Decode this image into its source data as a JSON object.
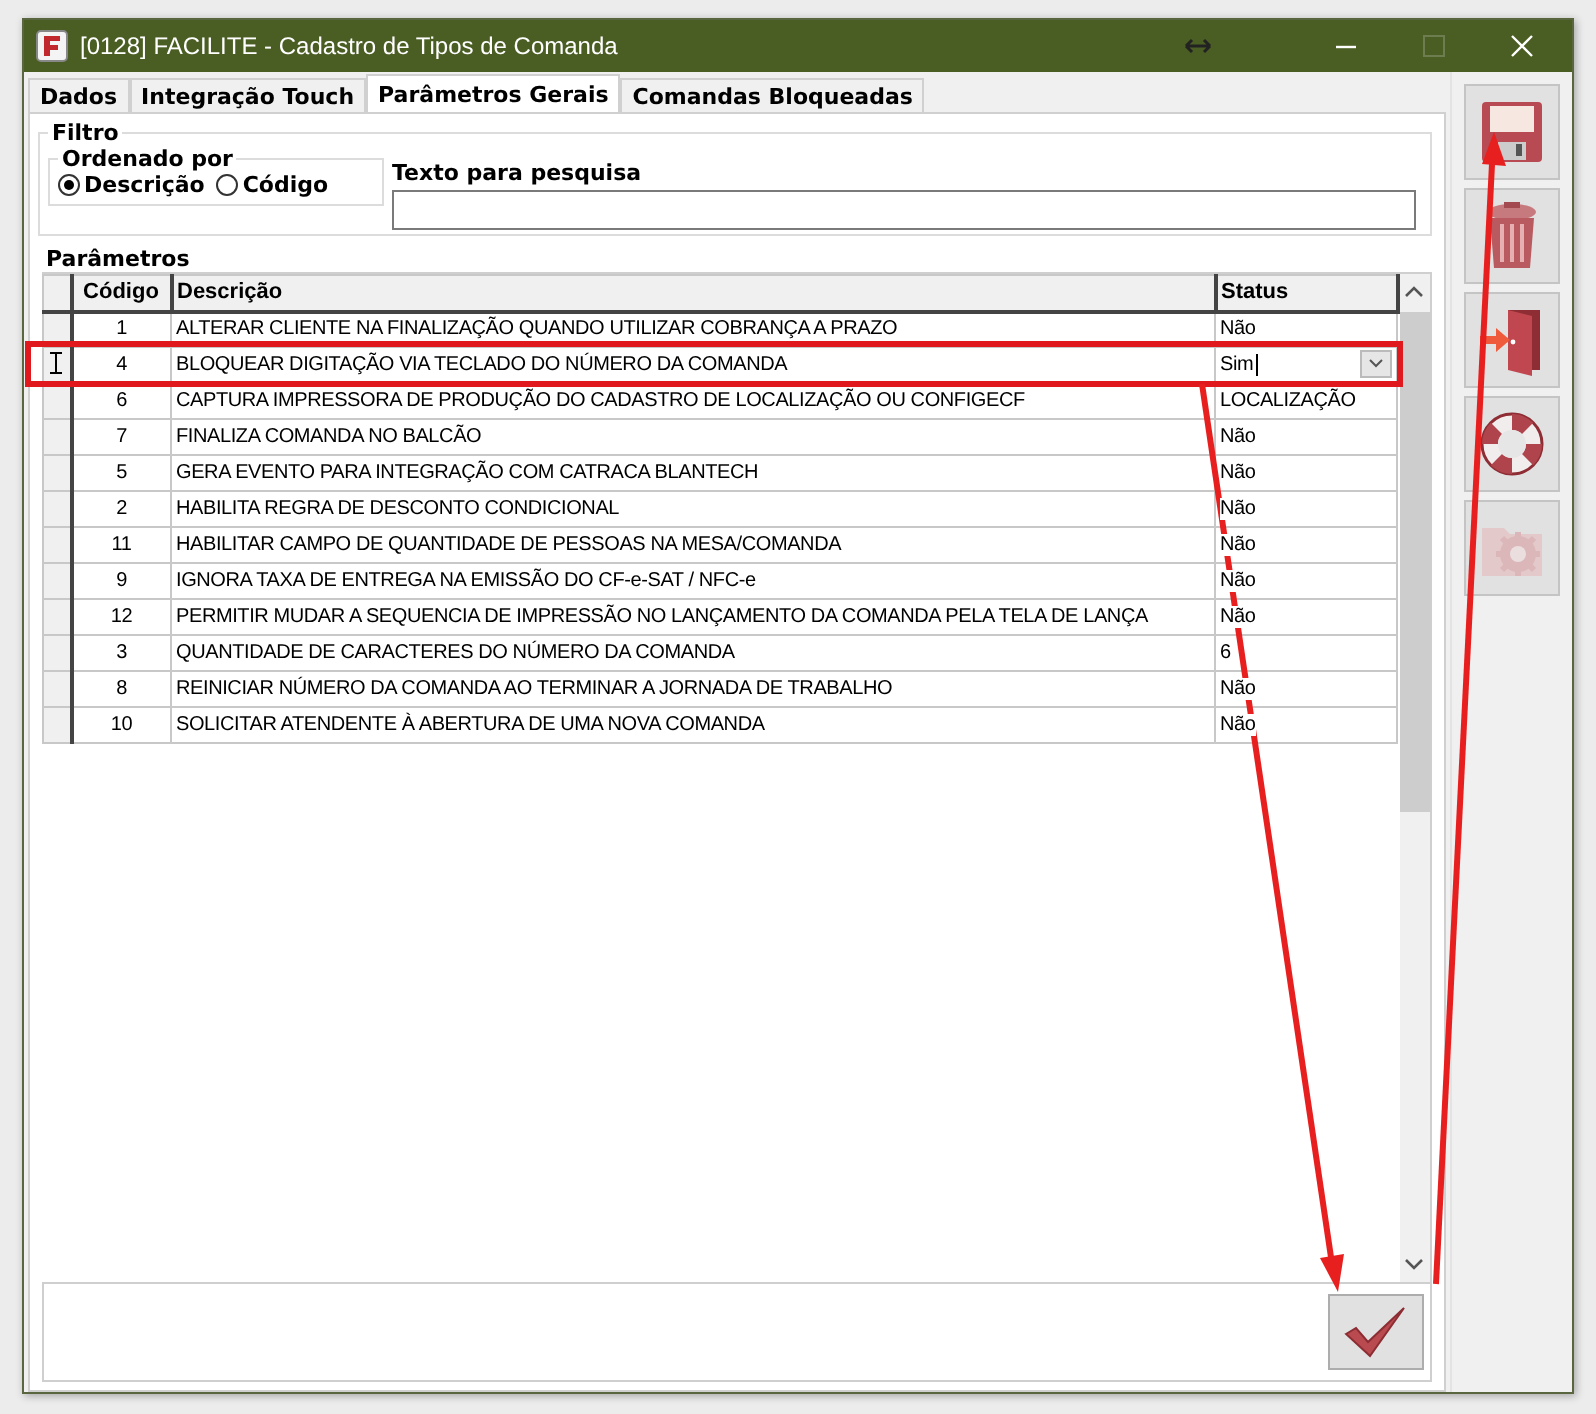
{
  "window": {
    "title": "[0128] FACILITE - Cadastro de Tipos de Comanda"
  },
  "tabs": [
    {
      "label": "Dados",
      "selected": false
    },
    {
      "label": "Integração Touch",
      "selected": false
    },
    {
      "label": "Parâmetros Gerais",
      "selected": true
    },
    {
      "label": "Comandas Bloqueadas",
      "selected": false
    }
  ],
  "filter": {
    "title": "Filtro",
    "order": {
      "title": "Ordenado por",
      "options": [
        {
          "label": "Descrição",
          "selected": true
        },
        {
          "label": "Código",
          "selected": false
        }
      ]
    },
    "search": {
      "label": "Texto para pesquisa"
    }
  },
  "params": {
    "title": "Parâmetros",
    "columns": [
      "Código",
      "Descrição",
      "Status"
    ],
    "rows": [
      {
        "code": "1",
        "description": "ALTERAR CLIENTE NA FINALIZAÇÃO QUANDO UTILIZAR COBRANÇA A PRAZO",
        "status": "Não",
        "selected": false
      },
      {
        "code": "4",
        "description": "BLOQUEAR DIGITAÇÃO VIA TECLADO DO NÚMERO DA COMANDA",
        "status": "Sim",
        "selected": true
      },
      {
        "code": "6",
        "description": "CAPTURA IMPRESSORA DE PRODUÇÃO DO CADASTRO DE LOCALIZAÇÃO OU CONFIGECF",
        "status": "LOCALIZAÇÃO",
        "selected": false
      },
      {
        "code": "7",
        "description": "FINALIZA COMANDA NO BALCÃO",
        "status": "Não",
        "selected": false
      },
      {
        "code": "5",
        "description": "GERA EVENTO PARA INTEGRAÇÃO COM CATRACA BLANTECH",
        "status": "Não",
        "selected": false
      },
      {
        "code": "2",
        "description": "HABILITA REGRA DE DESCONTO CONDICIONAL",
        "status": "Não",
        "selected": false
      },
      {
        "code": "11",
        "description": "HABILITAR CAMPO DE QUANTIDADE DE PESSOAS NA MESA/COMANDA",
        "status": "Não",
        "selected": false
      },
      {
        "code": "9",
        "description": "IGNORA TAXA DE ENTREGA NA EMISSÃO DO CF-e-SAT / NFC-e",
        "status": "Não",
        "selected": false
      },
      {
        "code": "12",
        "description": "PERMITIR MUDAR A SEQUENCIA DE IMPRESSÃO NO LANÇAMENTO DA COMANDA PELA TELA DE LANÇA",
        "status": "Não",
        "selected": false
      },
      {
        "code": "3",
        "description": "QUANTIDADE DE CARACTERES DO NÚMERO DA COMANDA",
        "status": "6",
        "selected": false
      },
      {
        "code": "8",
        "description": "REINICIAR NÚMERO DA COMANDA AO TERMINAR A JORNADA DE TRABALHO",
        "status": "Não",
        "selected": false
      },
      {
        "code": "10",
        "description": "SOLICITAR ATENDENTE À ABERTURA DE UMA NOVA COMANDA",
        "status": "Não",
        "selected": false
      }
    ]
  },
  "toolbar": [
    {
      "kind": "save",
      "disabled": false
    },
    {
      "kind": "trash",
      "disabled": false
    },
    {
      "kind": "exit",
      "disabled": false
    },
    {
      "kind": "help",
      "disabled": false
    },
    {
      "kind": "settings",
      "disabled": true
    }
  ]
}
